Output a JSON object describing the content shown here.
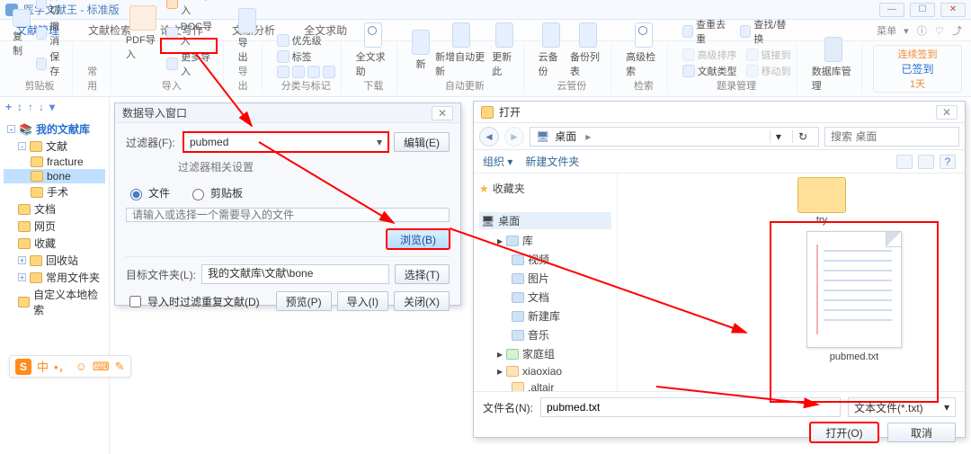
{
  "app": {
    "title": "医学文献王 - 标准版"
  },
  "menu": {
    "tabs": [
      "文献管理",
      "文献检索",
      "论文写作",
      "文献分析",
      "全文求助"
    ],
    "menu_label": "菜单",
    "module_label": ""
  },
  "ribbon": {
    "copy": "复制",
    "cut": "剪切",
    "undo": "撤消",
    "save": "保存",
    "clipboard_group": "剪贴板",
    "common_group": "常用",
    "pdf_import": "PDF导入",
    "ral_import": "RAL导入",
    "doc_import": "DOC导入",
    "more_import": "更多导入",
    "import_group": "导入",
    "export": "导出",
    "export_group": "导出",
    "priority": "优先级",
    "tag": "标签",
    "group": "",
    "mark_group": "分类与标记",
    "fulltext": "全文求助",
    "fulltext_group": "下载",
    "new": "新",
    "add_auto": "新增自动更新",
    "update_this": "更新此",
    "auto_group": "自动更新",
    "cloud_backup": "云备份",
    "backup_list": "备份列表",
    "cloud_group": "云管份",
    "adv_search": "高级检索",
    "search_group": "检索",
    "dedupe": "查重去重",
    "find_replace": "查找/替换",
    "adv_sort": "高级排序",
    "link": "链接到",
    "ref_type": "文献类型",
    "manage": "题录管理",
    "db_group": "数据库管理",
    "sign": {
      "hint": "连续签到",
      "status": "已签到",
      "days": "1天"
    }
  },
  "tree": {
    "root": "我的文献库",
    "items": [
      "文献",
      "fracture",
      "bone",
      "手术",
      "文档",
      "网页",
      "收藏",
      "回收站",
      "常用文件夹",
      "自定义本地检索"
    ]
  },
  "ime": {
    "label": "中"
  },
  "import_dlg": {
    "title": "数据导入窗口",
    "close": "✕",
    "filter_label": "过滤器(F):",
    "filter_value": "pubmed",
    "edit_btn": "编辑(E)",
    "filter_setting": "过滤器相关设置",
    "opt_file": "文件",
    "opt_clip": "剪贴板",
    "placeholder": "请输入或选择一个需要导入的文件",
    "browse": "浏览(B)",
    "target_label": "目标文件夹(L):",
    "target_path": "我的文献库\\文献\\bone",
    "select": "选择(T)",
    "chk": "导入时过滤重复文献(D)",
    "preview": "预览(P)",
    "import": "导入(I)",
    "cancel": "关闭(X)"
  },
  "file_dlg": {
    "title": "打开",
    "close": "✕",
    "back": "◄",
    "fwd": "►",
    "crumb_icon": "■",
    "crumb": "桌面",
    "refresh": "↻",
    "search_ph": "搜索 桌面",
    "organize": "组织 ▾",
    "newfolder": "新建文件夹",
    "fav": "收藏夹",
    "desktop": "桌面",
    "lib": "库",
    "video": "视频",
    "pics": "图片",
    "docs": "文档",
    "newlib": "新建库",
    "music": "音乐",
    "homegrp": "家庭组",
    "user": "xiaoxiao",
    "altair": ".altair",
    "try_folder": "try",
    "doc_name": "pubmed.txt",
    "fname_label": "文件名(N):",
    "fname_val": "pubmed.txt",
    "filter": "文本文件(*.txt)",
    "open": "打开(O)",
    "cancel": "取消"
  }
}
